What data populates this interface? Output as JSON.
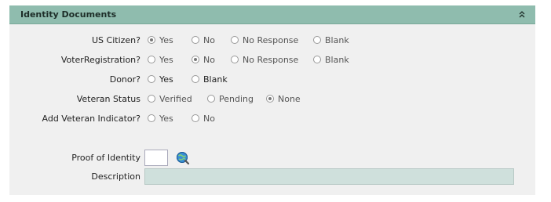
{
  "panel": {
    "title": "Identity Documents",
    "collapse_icon": "double-chevron-up-icon"
  },
  "rows": {
    "us_citizen": {
      "label": "US Citizen?",
      "options": [
        "Yes",
        "No",
        "No Response",
        "Blank"
      ],
      "selected": "Yes"
    },
    "voter_registration": {
      "label": "VoterRegistration?",
      "options": [
        "Yes",
        "No",
        "No Response",
        "Blank"
      ],
      "selected": "No"
    },
    "donor": {
      "label": "Donor?",
      "options": [
        "Yes",
        "Blank"
      ],
      "selected": null
    },
    "veteran_status": {
      "label": "Veteran Status",
      "options": [
        "Verified",
        "Pending",
        "None"
      ],
      "selected": "None"
    },
    "add_veteran_indicator": {
      "label": "Add Veteran Indicator?",
      "options": [
        "Yes",
        "No"
      ],
      "selected": null
    }
  },
  "proof_of_identity": {
    "label": "Proof of Identity",
    "value": "",
    "lookup_icon": "globe-search-icon"
  },
  "description": {
    "label": "Description",
    "value": ""
  }
}
